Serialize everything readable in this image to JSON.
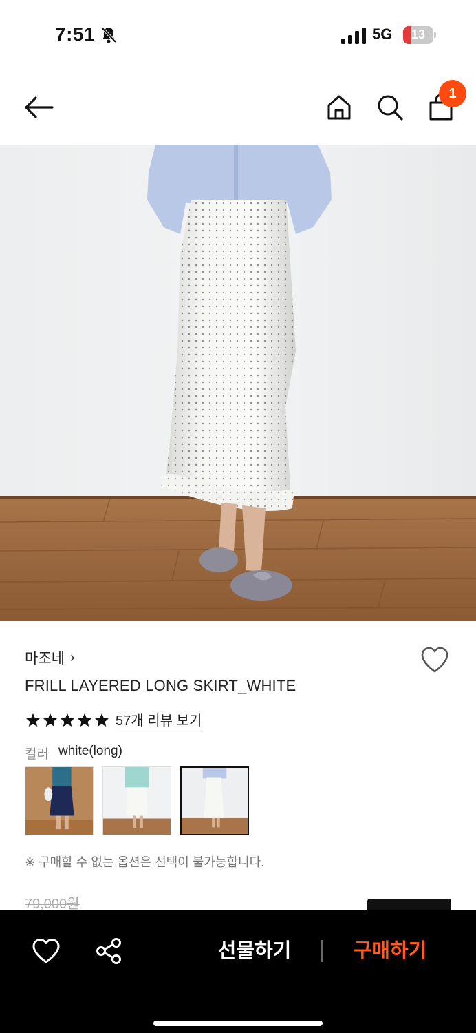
{
  "status_bar": {
    "time": "7:51",
    "network": "5G",
    "battery": "13",
    "bell_icon": "bell-slash-icon",
    "signal_icon": "signal-bars-icon"
  },
  "nav": {
    "icons": [
      "back-arrow-icon",
      "home-icon",
      "search-icon",
      "shopping-bag-icon"
    ],
    "cart_count": "1",
    "accent": "#ff4a10"
  },
  "product": {
    "brand": "마조네",
    "brand_chevron": "›",
    "name": "FRILL LAYERED LONG SKIRT_WHITE",
    "rating_stars": 5,
    "review_link": "57개 리뷰 보기",
    "option_label": "컬러",
    "option_value": "white(long)",
    "thumbnails": [
      "navy",
      "mint",
      "white(long)"
    ],
    "selected_thumbnail": 2,
    "notice": "※ 구매할 수 없는 옵션은 선택이 불가능합니다.",
    "original_price": "79,000원"
  },
  "bottom_bar": {
    "gift_label": "선물하기",
    "buy_label": "구매하기",
    "buy_color": "#ff5a1f",
    "icons": [
      "heart-icon",
      "share-icon"
    ]
  }
}
